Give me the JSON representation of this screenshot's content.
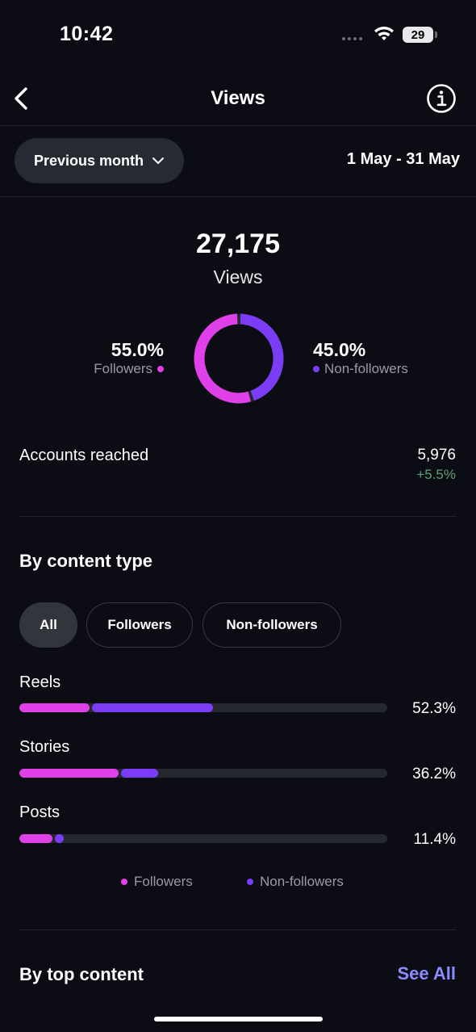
{
  "status_bar": {
    "time": "10:42",
    "battery": "29"
  },
  "header": {
    "title": "Views"
  },
  "period": {
    "selector_label": "Previous month",
    "date_range": "1 May - 31 May"
  },
  "totals": {
    "value": "27,175",
    "label": "Views"
  },
  "split": {
    "followers": {
      "percent": "55.0%",
      "label": "Followers",
      "fraction": 0.55,
      "color": "#e040e8"
    },
    "non_followers": {
      "percent": "45.0%",
      "label": "Non-followers",
      "fraction": 0.45,
      "color": "#7b3cf5"
    }
  },
  "accounts_reached": {
    "label": "Accounts reached",
    "value": "5,976",
    "change": "+5.5%"
  },
  "content_type": {
    "title": "By content type",
    "filters": [
      "All",
      "Followers",
      "Non-followers"
    ],
    "active_filter": "All",
    "rows": [
      {
        "label": "Reels",
        "percent": "52.3%",
        "followers_share": 0.19,
        "non_followers_share": 0.33
      },
      {
        "label": "Stories",
        "percent": "36.2%",
        "followers_share": 0.27,
        "non_followers_share": 0.1
      },
      {
        "label": "Posts",
        "percent": "11.4%",
        "followers_share": 0.09,
        "non_followers_share": 0.025
      }
    ],
    "legend": {
      "followers": "Followers",
      "non_followers": "Non-followers"
    }
  },
  "top_content": {
    "title": "By top content",
    "see_all": "See All"
  }
}
